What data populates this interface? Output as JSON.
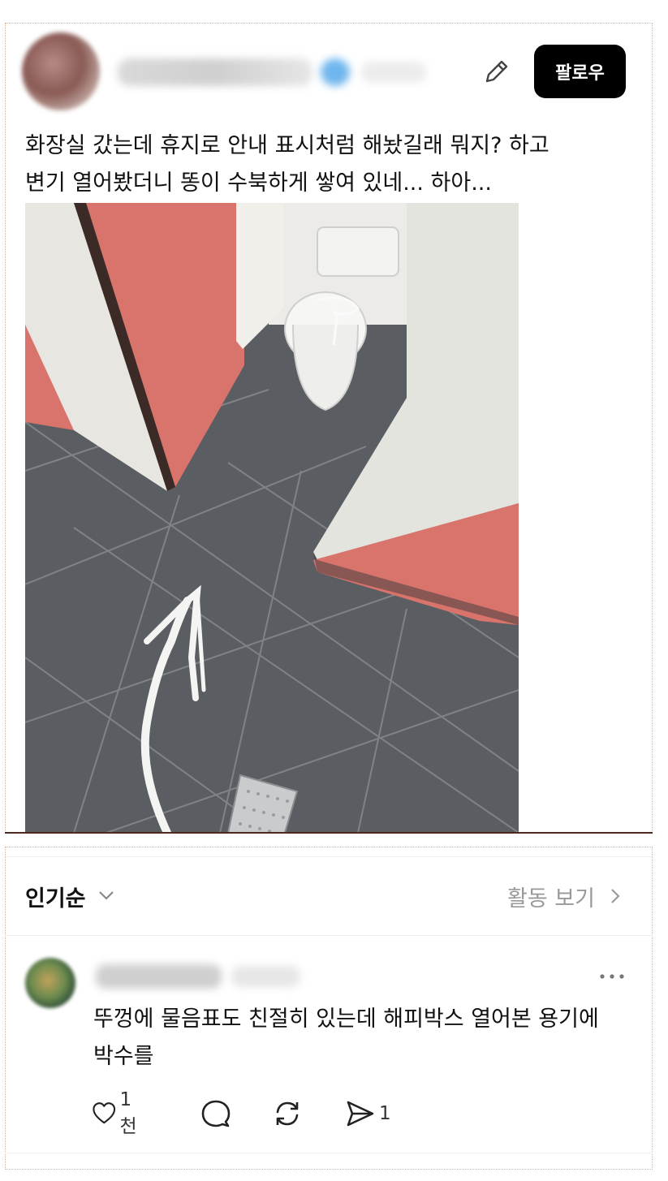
{
  "post": {
    "follow_label": "팔로우",
    "text_lines": [
      "화장실 갔는데 휴지로 안내 표시처럼 해놨길래 뭐지? 하고",
      "변기 열어봤더니 똥이 수북하게 쌓여 있네... 하아..."
    ],
    "icons": {
      "edit": "pencil-icon"
    }
  },
  "comments_section": {
    "sort_label": "인기순",
    "activity_label": "활동 보기",
    "comment": {
      "text_lines": [
        "뚜껑에 물음표도 친절히 있는데 해피박스 열어본 용기에",
        "박수를"
      ],
      "like_count": "1천",
      "share_count": "1"
    }
  },
  "colors": {
    "follow_button_bg": "#000000",
    "partition_coral": "#d9746c",
    "floor_gray": "#5c5f63",
    "muted_text": "#999999"
  }
}
